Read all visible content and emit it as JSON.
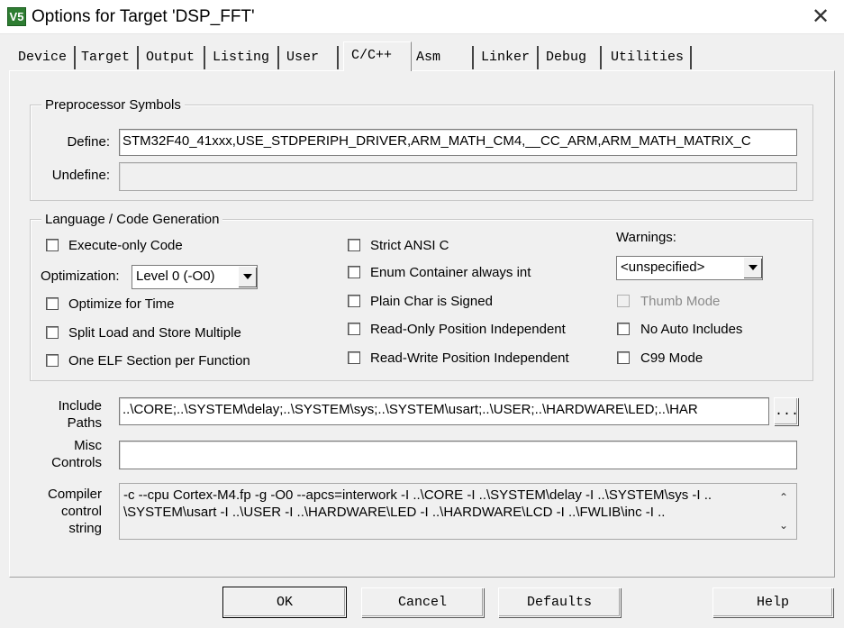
{
  "window": {
    "title": "Options for Target 'DSP_FFT'",
    "app_icon_text": "V5",
    "close_glyph": "✕"
  },
  "tabs": [
    {
      "label": "Device",
      "active": false
    },
    {
      "label": "Target",
      "active": false
    },
    {
      "label": "Output",
      "active": false
    },
    {
      "label": "Listing",
      "active": false
    },
    {
      "label": "User",
      "active": false
    },
    {
      "label": "C/C++",
      "active": true
    },
    {
      "label": "Asm",
      "active": false
    },
    {
      "label": "Linker",
      "active": false
    },
    {
      "label": "Debug",
      "active": false
    },
    {
      "label": "Utilities",
      "active": false
    }
  ],
  "preprocessor": {
    "legend": "Preprocessor Symbols",
    "define_label": "Define:",
    "define_value": "STM32F40_41xxx,USE_STDPERIPH_DRIVER,ARM_MATH_CM4,__CC_ARM,ARM_MATH_MATRIX_C",
    "undefine_label": "Undefine:",
    "undefine_value": ""
  },
  "language": {
    "legend": "Language / Code Generation",
    "execute_only": "Execute-only Code",
    "optimization_label": "Optimization:",
    "optimization_value": "Level 0 (-O0)",
    "optimize_time": "Optimize for Time",
    "split_load": "Split Load and Store Multiple",
    "one_elf": "One ELF Section per Function",
    "strict_ansi": "Strict ANSI C",
    "enum_container": "Enum Container always int",
    "plain_char": "Plain Char is Signed",
    "ro_pos": "Read-Only Position Independent",
    "rw_pos": "Read-Write Position Independent",
    "warnings_label": "Warnings:",
    "warnings_value": "<unspecified>",
    "thumb_mode": "Thumb Mode",
    "no_auto_includes": "No Auto Includes",
    "c99_mode": "C99 Mode"
  },
  "include": {
    "label_line1": "Include",
    "label_line2": "Paths",
    "value": "..\\CORE;..\\SYSTEM\\delay;..\\SYSTEM\\sys;..\\SYSTEM\\usart;..\\USER;..\\HARDWARE\\LED;..\\HAR",
    "browse_label": "..."
  },
  "misc": {
    "label_line1": "Misc",
    "label_line2": "Controls",
    "value": ""
  },
  "compiler": {
    "label_line1": "Compiler",
    "label_line2": "control",
    "label_line3": "string",
    "line1": "-c --cpu Cortex-M4.fp -g -O0 --apcs=interwork -I ..\\CORE -I ..\\SYSTEM\\delay -I ..\\SYSTEM\\sys -I ..",
    "line2": "\\SYSTEM\\usart -I ..\\USER -I ..\\HARDWARE\\LED -I ..\\HARDWARE\\LCD -I ..\\FWLIB\\inc -I ..",
    "scroll_up": "⌃",
    "scroll_down": "⌄"
  },
  "buttons": {
    "ok": "OK",
    "cancel": "Cancel",
    "defaults": "Defaults",
    "help": "Help"
  }
}
